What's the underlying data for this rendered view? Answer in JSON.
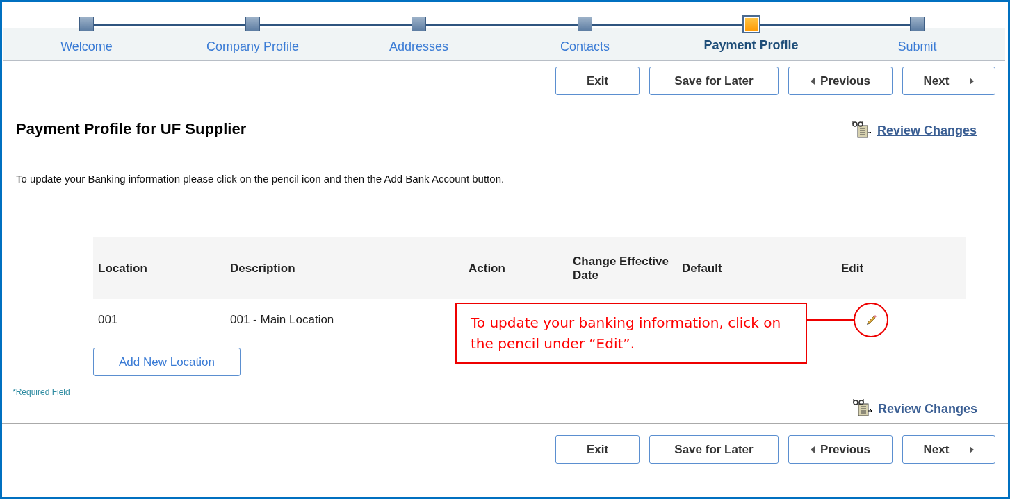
{
  "steps": [
    {
      "label": "Welcome",
      "selected": false
    },
    {
      "label": "Company Profile",
      "selected": false
    },
    {
      "label": "Addresses",
      "selected": false
    },
    {
      "label": "Contacts",
      "selected": false
    },
    {
      "label": "Payment Profile",
      "selected": true
    },
    {
      "label": "Submit",
      "selected": false
    }
  ],
  "top_buttons": [
    {
      "kind": "plain",
      "label": "Exit"
    },
    {
      "kind": "plain",
      "label": "Save for Later"
    },
    {
      "kind": "previous",
      "label": "Previous"
    },
    {
      "kind": "next",
      "label": "Next"
    }
  ],
  "title": "Payment Profile for UF Supplier",
  "review_link_top": "Review Changes",
  "instruction": "To update your Banking information please click on the pencil icon and then the Add Bank Account button.",
  "table": {
    "columns": [
      "Location",
      "Description",
      "Action",
      "Change Effective Date",
      "Default",
      "Edit"
    ],
    "rows": [
      {
        "location": "001",
        "description": "001 - Main Location"
      }
    ]
  },
  "add_button": "Add New Location",
  "required_note": "*Required Field",
  "review_link_bottom": "Review Changes",
  "callout": "To update your banking information, click on the pencil under “Edit”.",
  "bottom_buttons": [
    {
      "kind": "plain",
      "label": "Exit"
    },
    {
      "kind": "plain",
      "label": "Save for Later"
    },
    {
      "kind": "previous",
      "label": "Previous"
    },
    {
      "kind": "next",
      "label": "Next"
    }
  ]
}
